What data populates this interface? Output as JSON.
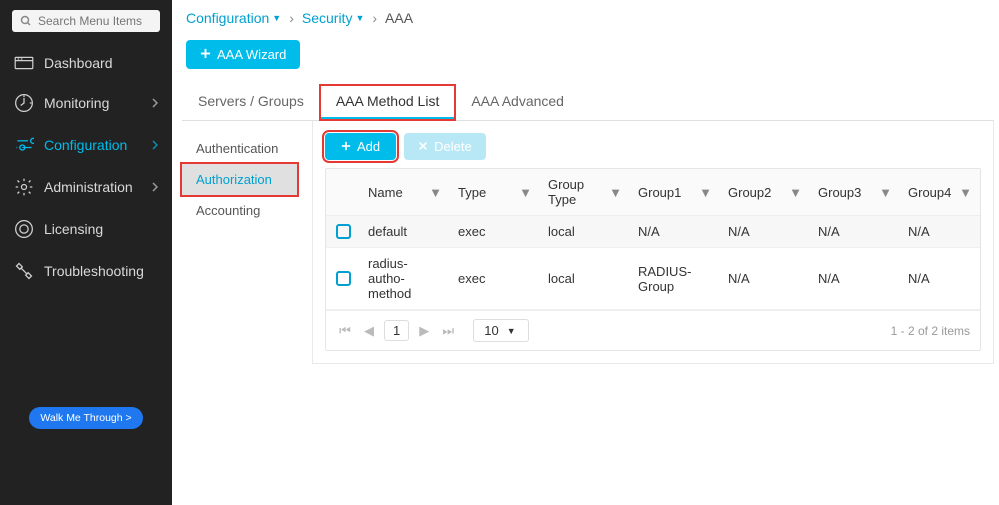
{
  "search": {
    "placeholder": "Search Menu Items"
  },
  "sidebar": {
    "items": [
      {
        "label": "Dashboard",
        "icon": "dashboard"
      },
      {
        "label": "Monitoring",
        "icon": "monitoring",
        "chev": true
      },
      {
        "label": "Configuration",
        "icon": "configuration",
        "chev": true,
        "active": true
      },
      {
        "label": "Administration",
        "icon": "administration",
        "chev": true
      },
      {
        "label": "Licensing",
        "icon": "licensing"
      },
      {
        "label": "Troubleshooting",
        "icon": "troubleshooting"
      }
    ],
    "walkme": "Walk Me Through >"
  },
  "breadcrumb": {
    "c0": "Configuration",
    "c1": "Security",
    "current": "AAA"
  },
  "wizard": "AAA Wizard",
  "tabs": {
    "t0": "Servers / Groups",
    "t1": "AAA Method List",
    "t2": "AAA Advanced"
  },
  "subtabs": {
    "s0": "Authentication",
    "s1": "Authorization",
    "s2": "Accounting"
  },
  "toolbar": {
    "add": "Add",
    "del": "Delete"
  },
  "grid": {
    "headers": {
      "name": "Name",
      "type": "Type",
      "gtype": "Group Type",
      "g1": "Group1",
      "g2": "Group2",
      "g3": "Group3",
      "g4": "Group4"
    },
    "rows": [
      {
        "name": "default",
        "type": "exec",
        "gtype": "local",
        "g1": "N/A",
        "g2": "N/A",
        "g3": "N/A",
        "g4": "N/A"
      },
      {
        "name": "radius-autho-method",
        "type": "exec",
        "gtype": "local",
        "g1": "RADIUS-Group",
        "g2": "N/A",
        "g3": "N/A",
        "g4": "N/A"
      }
    ]
  },
  "pager": {
    "page": "1",
    "size": "10",
    "summary": "1 - 2 of 2 items"
  }
}
